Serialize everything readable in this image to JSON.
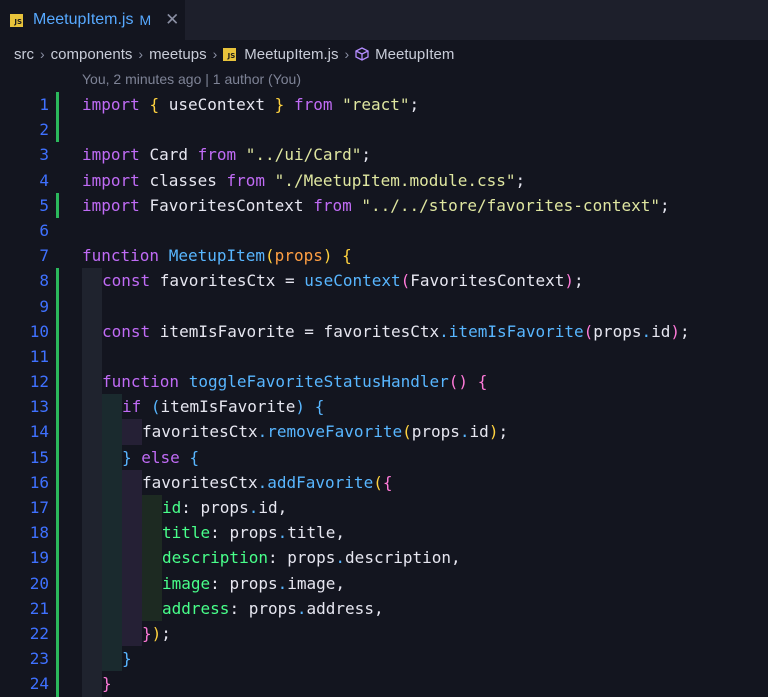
{
  "tab": {
    "badge": "JS",
    "title": "MeetupItem.js",
    "modified": "M",
    "close": "✕"
  },
  "breadcrumb": {
    "items": [
      "src",
      "components",
      "meetups"
    ],
    "file_badge": "JS",
    "file": "MeetupItem.js",
    "symbol": "MeetupItem"
  },
  "blame": "You, 2 minutes ago | 1 author (You)",
  "code_lines": [
    {
      "n": 1,
      "g": true,
      "i": 0,
      "t": [
        [
          "kw",
          "import "
        ],
        [
          "br",
          "{ "
        ],
        [
          "plain",
          "useContext "
        ],
        [
          "br",
          "} "
        ],
        [
          "kw",
          "from "
        ],
        [
          "str",
          "\"react\""
        ],
        [
          "plain",
          ";"
        ]
      ]
    },
    {
      "n": 2,
      "g": true,
      "i": 0,
      "t": []
    },
    {
      "n": 3,
      "g": false,
      "i": 0,
      "t": [
        [
          "kw",
          "import "
        ],
        [
          "plain",
          "Card "
        ],
        [
          "kw",
          "from "
        ],
        [
          "str",
          "\"../ui/Card\""
        ],
        [
          "plain",
          ";"
        ]
      ]
    },
    {
      "n": 4,
      "g": false,
      "i": 0,
      "t": [
        [
          "kw",
          "import "
        ],
        [
          "plain",
          "classes "
        ],
        [
          "kw",
          "from "
        ],
        [
          "str",
          "\"./MeetupItem.module.css\""
        ],
        [
          "plain",
          ";"
        ]
      ]
    },
    {
      "n": 5,
      "g": true,
      "i": 0,
      "t": [
        [
          "kw",
          "import "
        ],
        [
          "plain",
          "FavoritesContext "
        ],
        [
          "kw",
          "from "
        ],
        [
          "str",
          "\"../../store/favorites-context\""
        ],
        [
          "plain",
          ";"
        ]
      ]
    },
    {
      "n": 6,
      "g": false,
      "i": 0,
      "t": []
    },
    {
      "n": 7,
      "g": false,
      "i": 0,
      "t": [
        [
          "kw",
          "function "
        ],
        [
          "fn",
          "MeetupItem"
        ],
        [
          "br",
          "("
        ],
        [
          "ac",
          "props"
        ],
        [
          "br",
          ")"
        ],
        [
          "plain",
          " "
        ],
        [
          "br",
          "{"
        ]
      ]
    },
    {
      "n": 8,
      "g": true,
      "i": 1,
      "t": [
        [
          "kw",
          "const "
        ],
        [
          "plain",
          "favoritesCtx = "
        ],
        [
          "fn",
          "useContext"
        ],
        [
          "br2",
          "("
        ],
        [
          "plain",
          "FavoritesContext"
        ],
        [
          "br2",
          ")"
        ],
        [
          "plain",
          ";"
        ]
      ]
    },
    {
      "n": 9,
      "g": true,
      "i": 1,
      "t": []
    },
    {
      "n": 10,
      "g": true,
      "i": 1,
      "t": [
        [
          "kw",
          "const "
        ],
        [
          "plain",
          "itemIsFavorite = favoritesCtx"
        ],
        [
          "dot",
          "."
        ],
        [
          "fn",
          "itemIsFavorite"
        ],
        [
          "br2",
          "("
        ],
        [
          "plain",
          "props"
        ],
        [
          "dot",
          "."
        ],
        [
          "plain",
          "id"
        ],
        [
          "br2",
          ")"
        ],
        [
          "plain",
          ";"
        ]
      ]
    },
    {
      "n": 11,
      "g": true,
      "i": 1,
      "t": []
    },
    {
      "n": 12,
      "g": true,
      "i": 1,
      "t": [
        [
          "kw",
          "function "
        ],
        [
          "fn",
          "toggleFavoriteStatusHandler"
        ],
        [
          "br2",
          "() {"
        ]
      ]
    },
    {
      "n": 13,
      "g": true,
      "i": 2,
      "t": [
        [
          "kw",
          "if "
        ],
        [
          "br3",
          "("
        ],
        [
          "plain",
          "itemIsFavorite"
        ],
        [
          "br3",
          ")"
        ],
        [
          "plain",
          " "
        ],
        [
          "br3",
          "{"
        ]
      ]
    },
    {
      "n": 14,
      "g": true,
      "i": 3,
      "t": [
        [
          "plain",
          "favoritesCtx"
        ],
        [
          "dot",
          "."
        ],
        [
          "fn",
          "removeFavorite"
        ],
        [
          "br",
          "("
        ],
        [
          "plain",
          "props"
        ],
        [
          "dot",
          "."
        ],
        [
          "plain",
          "id"
        ],
        [
          "br",
          ")"
        ],
        [
          "plain",
          ";"
        ]
      ]
    },
    {
      "n": 15,
      "g": true,
      "i": 2,
      "t": [
        [
          "br3",
          "} "
        ],
        [
          "kw",
          "else "
        ],
        [
          "br3",
          "{"
        ]
      ]
    },
    {
      "n": 16,
      "g": true,
      "i": 3,
      "t": [
        [
          "plain",
          "favoritesCtx"
        ],
        [
          "dot",
          "."
        ],
        [
          "fn",
          "addFavorite"
        ],
        [
          "br",
          "("
        ],
        [
          "br2",
          "{"
        ]
      ]
    },
    {
      "n": 17,
      "g": true,
      "i": 4,
      "t": [
        [
          "prop",
          "id"
        ],
        [
          "plain",
          ": props"
        ],
        [
          "dot",
          "."
        ],
        [
          "plain",
          "id,"
        ]
      ]
    },
    {
      "n": 18,
      "g": true,
      "i": 4,
      "t": [
        [
          "prop",
          "title"
        ],
        [
          "plain",
          ": props"
        ],
        [
          "dot",
          "."
        ],
        [
          "plain",
          "title,"
        ]
      ]
    },
    {
      "n": 19,
      "g": true,
      "i": 4,
      "t": [
        [
          "prop",
          "description"
        ],
        [
          "plain",
          ": props"
        ],
        [
          "dot",
          "."
        ],
        [
          "plain",
          "description,"
        ]
      ]
    },
    {
      "n": 20,
      "g": true,
      "i": 4,
      "t": [
        [
          "prop",
          "image"
        ],
        [
          "plain",
          ": props"
        ],
        [
          "dot",
          "."
        ],
        [
          "plain",
          "image,"
        ]
      ]
    },
    {
      "n": 21,
      "g": true,
      "i": 4,
      "t": [
        [
          "prop",
          "address"
        ],
        [
          "plain",
          ": props"
        ],
        [
          "dot",
          "."
        ],
        [
          "plain",
          "address,"
        ]
      ]
    },
    {
      "n": 22,
      "g": true,
      "i": 3,
      "t": [
        [
          "br2",
          "}"
        ],
        [
          "br",
          ")"
        ],
        [
          "plain",
          ";"
        ]
      ]
    },
    {
      "n": 23,
      "g": true,
      "i": 2,
      "t": [
        [
          "br3",
          "}"
        ]
      ]
    },
    {
      "n": 24,
      "g": true,
      "i": 1,
      "t": [
        [
          "br2",
          "}"
        ]
      ]
    }
  ]
}
